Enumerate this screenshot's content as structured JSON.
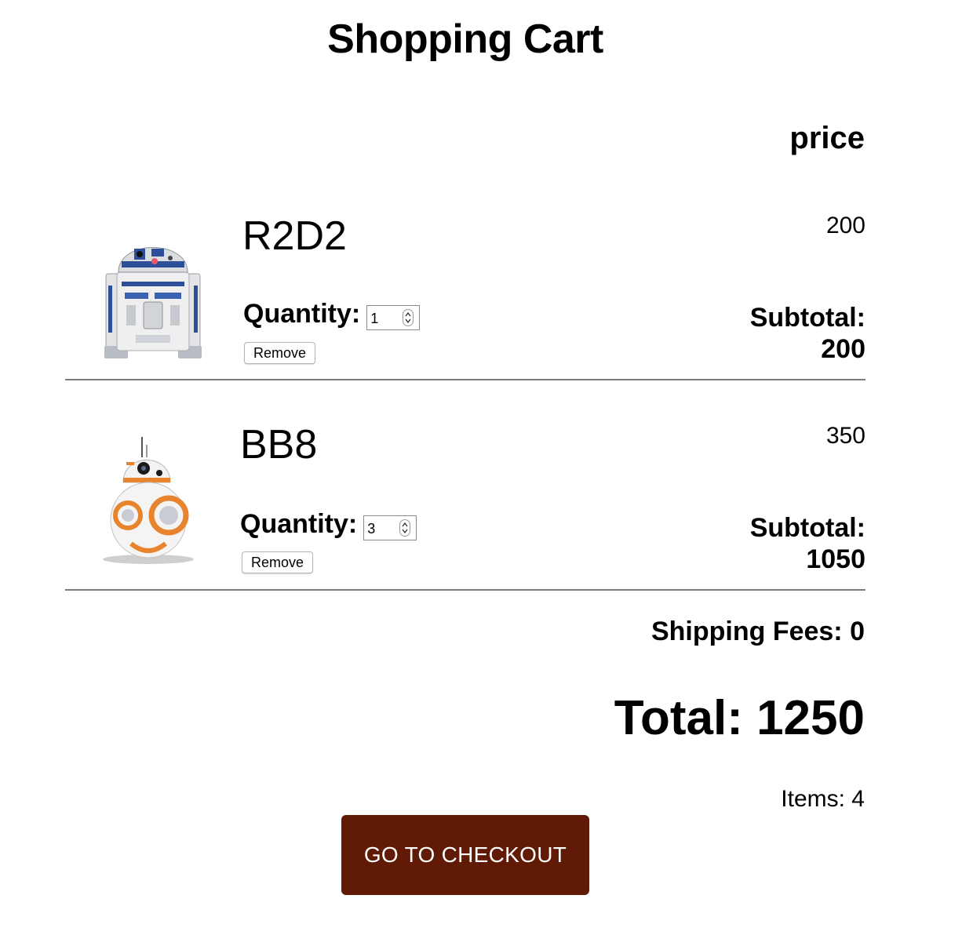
{
  "page": {
    "title": "Shopping Cart"
  },
  "cart": {
    "price_header": "price",
    "items": [
      {
        "name": "R2D2",
        "price": "200",
        "quantity_label": "Quantity:",
        "quantity": "1",
        "remove_label": "Remove",
        "subtotal_label": "Subtotal:",
        "subtotal": "200",
        "image": "r2d2-robot-image"
      },
      {
        "name": "BB8",
        "price": "350",
        "quantity_label": "Quantity:",
        "quantity": "3",
        "remove_label": "Remove",
        "subtotal_label": "Subtotal:",
        "subtotal": "1050",
        "image": "bb8-robot-image"
      }
    ]
  },
  "summary": {
    "shipping": "Shipping Fees: 0",
    "total": "Total: 1250",
    "items": "Items: 4",
    "checkout_label": "GO TO CHECKOUT"
  },
  "colors": {
    "checkout_bg": "#611a06",
    "divider": "#7a7a7a"
  }
}
